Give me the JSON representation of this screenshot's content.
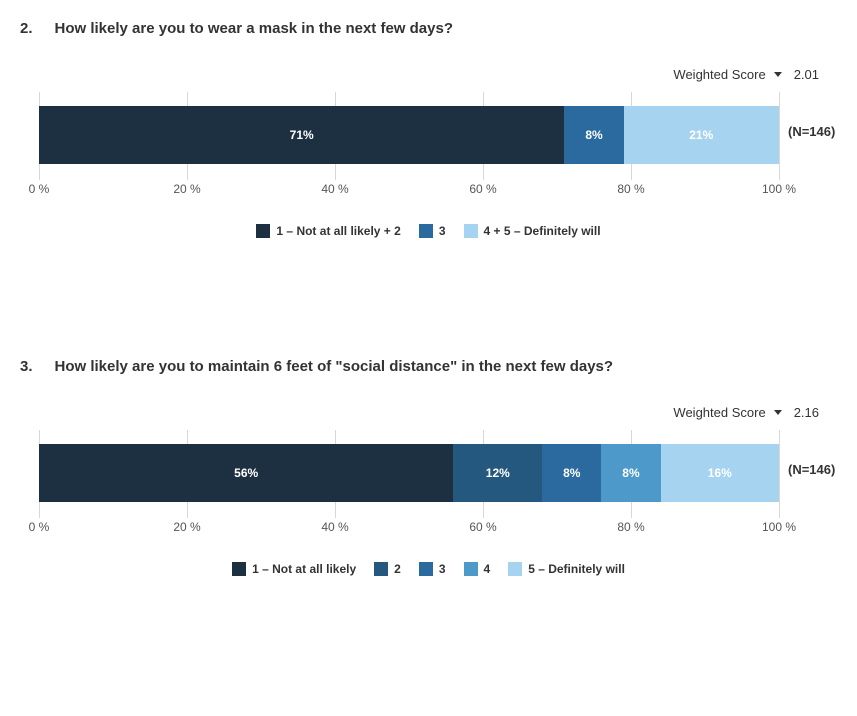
{
  "chart_data": [
    {
      "type": "bar",
      "title": "How likely are you to wear a mask in the next few days?",
      "xlabel": "",
      "ylabel": "",
      "categories": [
        "1 – Not at all likely + 2",
        "3",
        "4 + 5 – Definitely will"
      ],
      "values": [
        71,
        8,
        21
      ],
      "xlim": [
        0,
        100
      ],
      "n": 146,
      "weighted_score": 2.01,
      "colors": [
        "#1C3042",
        "#2A6A9E",
        "#A6D3F0"
      ]
    },
    {
      "type": "bar",
      "title": "How likely are you to maintain 6 feet of \"social distance\" in the next few days?",
      "xlabel": "",
      "ylabel": "",
      "categories": [
        "1 – Not at all likely",
        "2",
        "3",
        "4",
        "5 – Definitely will"
      ],
      "values": [
        56,
        12,
        8,
        8,
        16
      ],
      "xlim": [
        0,
        100
      ],
      "n": 146,
      "weighted_score": 2.16,
      "colors": [
        "#1C3042",
        "#25587E",
        "#2A6A9E",
        "#4D99C9",
        "#A6D3F0"
      ]
    }
  ],
  "axis_ticks": [
    "0 %",
    "20 %",
    "40 %",
    "60 %",
    "80 %",
    "100 %"
  ],
  "questions": [
    {
      "number": "2.",
      "text": "How likely are you to wear a mask in the next few days?",
      "score_label": "Weighted Score",
      "score_value": "2.01",
      "n_label": "(N=146)",
      "segments": [
        {
          "value": 71,
          "label": "71%",
          "color": "#1C3042"
        },
        {
          "value": 8,
          "label": "8%",
          "color": "#2A6A9E"
        },
        {
          "value": 21,
          "label": "21%",
          "color": "#A6D3F0"
        }
      ],
      "legend": [
        {
          "color": "#1C3042",
          "label": "1 – Not at all likely + 2"
        },
        {
          "color": "#2A6A9E",
          "label": "3"
        },
        {
          "color": "#A6D3F0",
          "label": "4 + 5 – Definitely will"
        }
      ]
    },
    {
      "number": "3.",
      "text": "How likely are you to maintain 6 feet of \"social distance\" in the next few days?",
      "score_label": "Weighted Score",
      "score_value": "2.16",
      "n_label": "(N=146)",
      "segments": [
        {
          "value": 56,
          "label": "56%",
          "color": "#1C3042"
        },
        {
          "value": 12,
          "label": "12%",
          "color": "#25587E"
        },
        {
          "value": 8,
          "label": "8%",
          "color": "#2A6A9E"
        },
        {
          "value": 8,
          "label": "8%",
          "color": "#4D99C9"
        },
        {
          "value": 16,
          "label": "16%",
          "color": "#A6D3F0"
        }
      ],
      "legend": [
        {
          "color": "#1C3042",
          "label": "1 – Not at all likely"
        },
        {
          "color": "#25587E",
          "label": "2"
        },
        {
          "color": "#2A6A9E",
          "label": "3"
        },
        {
          "color": "#4D99C9",
          "label": "4"
        },
        {
          "color": "#A6D3F0",
          "label": "5 – Definitely will"
        }
      ]
    }
  ]
}
